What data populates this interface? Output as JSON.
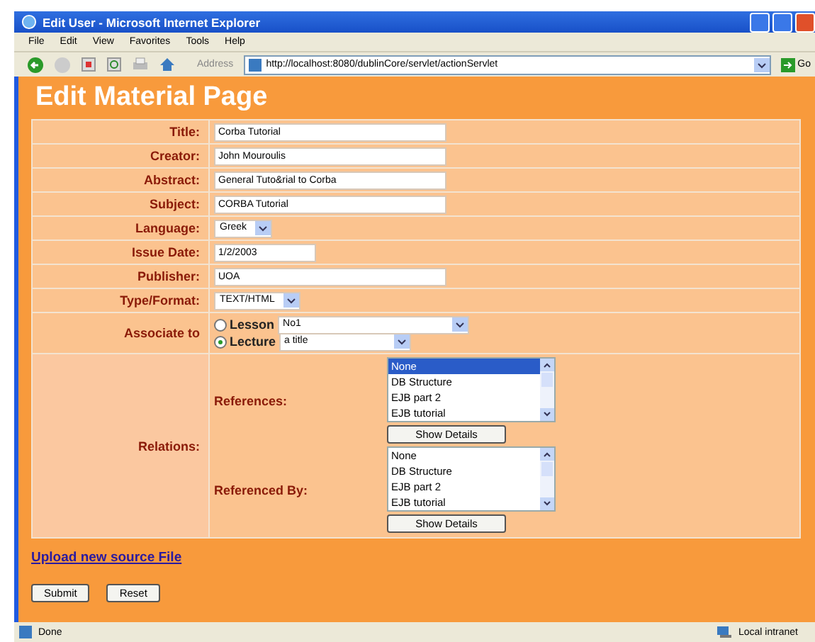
{
  "window": {
    "title": "Edit User - Microsoft Internet Explorer"
  },
  "menu": [
    "File",
    "Edit",
    "View",
    "Favorites",
    "Tools",
    "Help"
  ],
  "address": {
    "label": "Address",
    "url": "http://localhost:8080/dublinCore/servlet/actionServlet",
    "go": "Go"
  },
  "heading": "Edit Material Page",
  "fields": [
    {
      "kind": "text",
      "label": "Title:",
      "value": "Corba Tutorial"
    },
    {
      "kind": "text",
      "label": "Creator:",
      "value": "John Mouroulis"
    },
    {
      "kind": "text",
      "label": "Abstract:",
      "value": "General Tuto&rial  to Corba"
    },
    {
      "kind": "text",
      "label": "Subject:",
      "value": "CORBA Tutorial"
    },
    {
      "kind": "select",
      "label": "Language:",
      "value": "Greek"
    },
    {
      "kind": "date",
      "label": "Issue Date:",
      "value": "1/2/2003"
    },
    {
      "kind": "text",
      "label": "Publisher:",
      "value": "UOA"
    },
    {
      "kind": "select",
      "label": "Type/Format:",
      "value": "TEXT/HTML"
    }
  ],
  "associate": {
    "label": "Associate to",
    "options": [
      {
        "label": "Lesson",
        "selected": false,
        "value": "No1"
      },
      {
        "label": "Lecture",
        "selected": true,
        "value": "a title"
      }
    ]
  },
  "relations": {
    "label": "Relations:",
    "groups": [
      {
        "label": "References:",
        "items": [
          {
            "text": "None",
            "selected": true
          },
          {
            "text": "DB Structure",
            "selected": false
          },
          {
            "text": "EJB part 2",
            "selected": false
          },
          {
            "text": "EJB tutorial",
            "selected": false
          }
        ],
        "button": "Show Details"
      },
      {
        "label": "Referenced By:",
        "items": [
          {
            "text": "None",
            "selected": false
          },
          {
            "text": "DB Structure",
            "selected": false
          },
          {
            "text": "EJB part 2",
            "selected": false
          },
          {
            "text": "EJB tutorial",
            "selected": false
          }
        ],
        "button": "Show Details"
      }
    ]
  },
  "upload_link": "Upload new source File",
  "buttons": [
    "Submit",
    "Reset"
  ],
  "status_bar": {
    "status": "Done",
    "zone": "Local intranet"
  }
}
